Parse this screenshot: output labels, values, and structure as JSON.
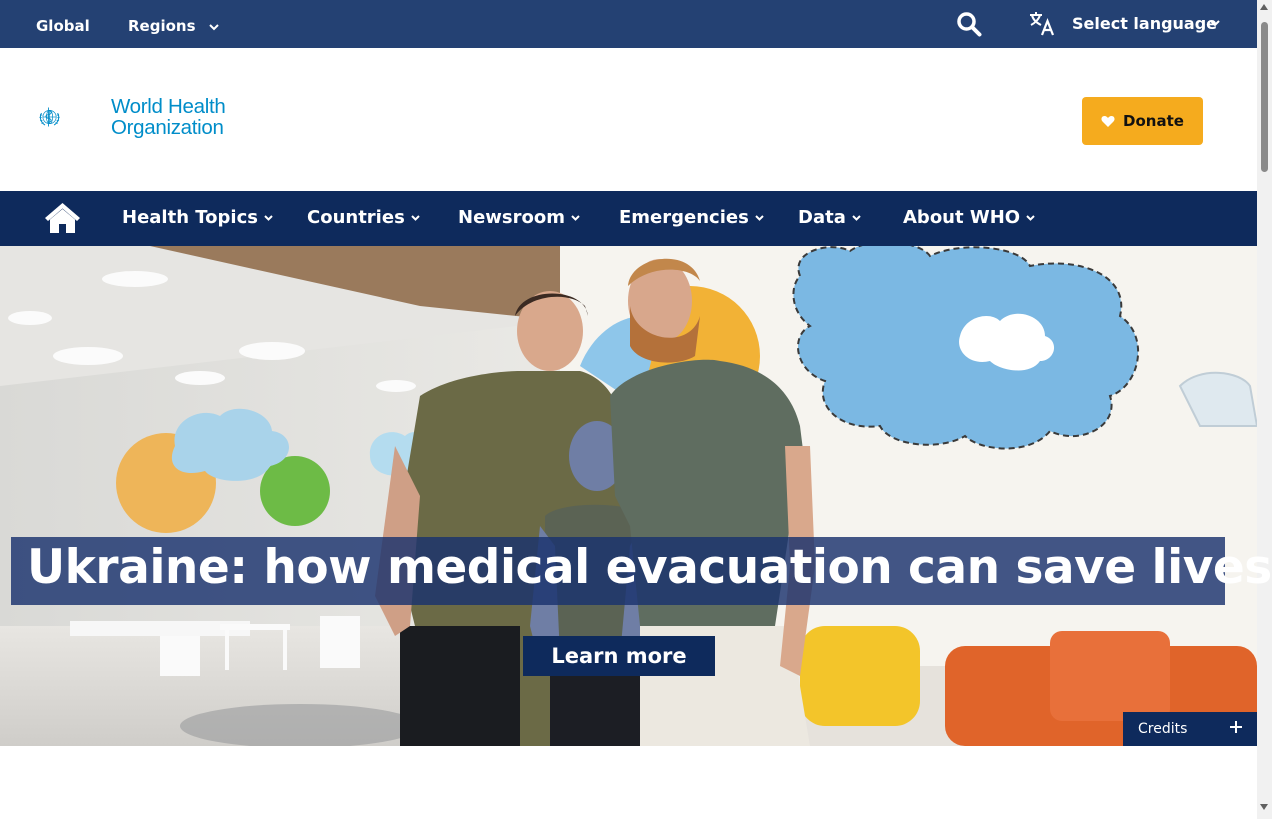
{
  "topbar": {
    "global_label": "Global",
    "regions_label": "Regions",
    "language_label": "Select language"
  },
  "header": {
    "logo_line1": "World Health",
    "logo_line2": "Organization",
    "donate_label": "Donate"
  },
  "nav": {
    "items": [
      {
        "label": "Health Topics"
      },
      {
        "label": "Countries"
      },
      {
        "label": "Newsroom"
      },
      {
        "label": "Emergencies"
      },
      {
        "label": "Data"
      },
      {
        "label": "About WHO"
      }
    ]
  },
  "hero": {
    "title": "Ukraine: how medical evacuation can save lives",
    "cta_label": "Learn more",
    "credits_label": "Credits"
  },
  "colors": {
    "topbar": "#244173",
    "nav": "#0e2a5c",
    "donate": "#f5ab1e",
    "logo": "#008dc9"
  },
  "icons": [
    "search-icon",
    "translate-icon",
    "chevron-down-icon",
    "home-icon",
    "heart-icon",
    "plus-icon",
    "who-emblem-icon"
  ]
}
